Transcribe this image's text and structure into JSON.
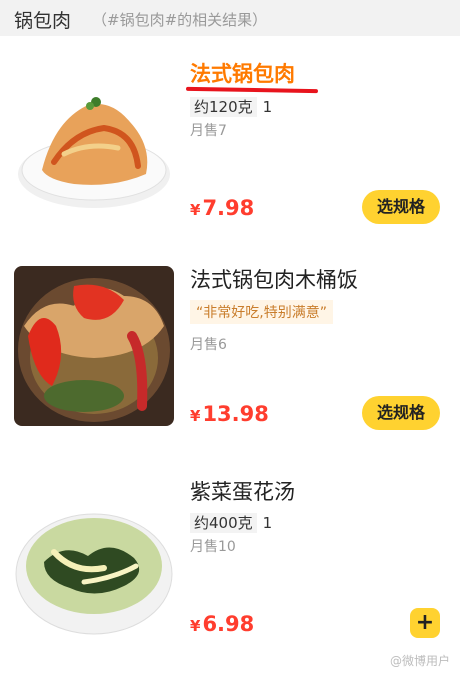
{
  "header": {
    "title": "锅包肉",
    "subtitle": "（#锅包肉#的相关结果）"
  },
  "items": [
    {
      "name": "法式锅包肉",
      "spec": "约120克",
      "spec_qty": "1",
      "sales": "月售7",
      "price_symbol": "¥",
      "price": "7.98",
      "button": "选规格"
    },
    {
      "name": "法式锅包肉木桶饭",
      "review": "“非常好吃,特别满意”",
      "sales": "月售6",
      "price_symbol": "¥",
      "price": "13.98",
      "button": "选规格"
    },
    {
      "name": "紫菜蛋花汤",
      "spec": "约400克",
      "spec_qty": "1",
      "sales": "月售10",
      "price_symbol": "¥",
      "price": "6.98",
      "button": "+"
    }
  ],
  "watermark": "@微博用户",
  "colors": {
    "price": "#ff3d2e",
    "button": "#ffd230",
    "highlight": "#ff7a00",
    "underline": "#e8141d"
  }
}
